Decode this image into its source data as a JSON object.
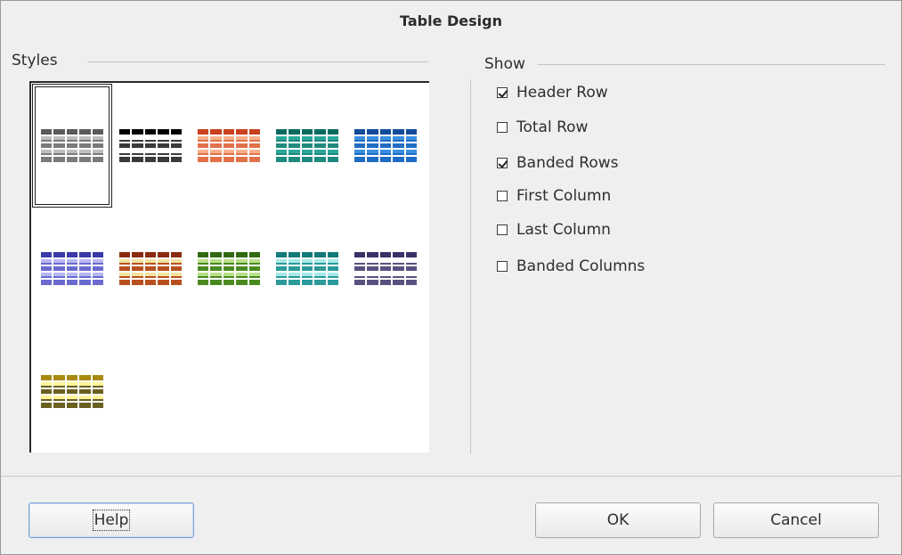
{
  "dialog": {
    "title": "Table Design"
  },
  "styles": {
    "label": "Styles",
    "selected_index": 0,
    "thumbnails": [
      {
        "id": "default",
        "header": "#5a5a5a",
        "band": "#bdbdbd",
        "body": "#7a7a7a"
      },
      {
        "id": "black",
        "header": "#000000",
        "band": "#ffffff",
        "body": "#3a3a3a"
      },
      {
        "id": "orange",
        "header": "#c8401e",
        "band": "#f7b08a",
        "body": "#e2714a"
      },
      {
        "id": "turquoise",
        "header": "#0a6a60",
        "band": "#2aa89a",
        "body": "#1f8a7e"
      },
      {
        "id": "blue",
        "header": "#114b9a",
        "band": "#3a8fe0",
        "body": "#1f6cc4"
      },
      {
        "id": "lavender",
        "header": "#3a3aa8",
        "band": "#b8b8f2",
        "body": "#6a6ad0"
      },
      {
        "id": "brown-yellow",
        "header": "#8a2a10",
        "band": "#f2e4a0",
        "body": "#b8501e"
      },
      {
        "id": "green",
        "header": "#2f6a10",
        "band": "#b8e08a",
        "body": "#4a8a1e"
      },
      {
        "id": "teal",
        "header": "#127a7a",
        "band": "#a8e8e8",
        "body": "#2a9a9a"
      },
      {
        "id": "gray-purple",
        "header": "#3a3066",
        "band": "#ffffff",
        "body": "#5a5080"
      },
      {
        "id": "yellow",
        "header": "#a88a10",
        "band": "#fff49a",
        "body": "#6a6020"
      }
    ]
  },
  "show": {
    "label": "Show",
    "options": [
      {
        "label": "Header Row",
        "checked": true
      },
      {
        "label": "Total Row",
        "checked": false
      },
      {
        "label": "Banded Rows",
        "checked": true
      },
      {
        "label": "First Column",
        "checked": false
      },
      {
        "label": "Last Column",
        "checked": false
      },
      {
        "label": "Banded Columns",
        "checked": false
      }
    ]
  },
  "buttons": {
    "help": "Help",
    "ok": "OK",
    "cancel": "Cancel"
  }
}
